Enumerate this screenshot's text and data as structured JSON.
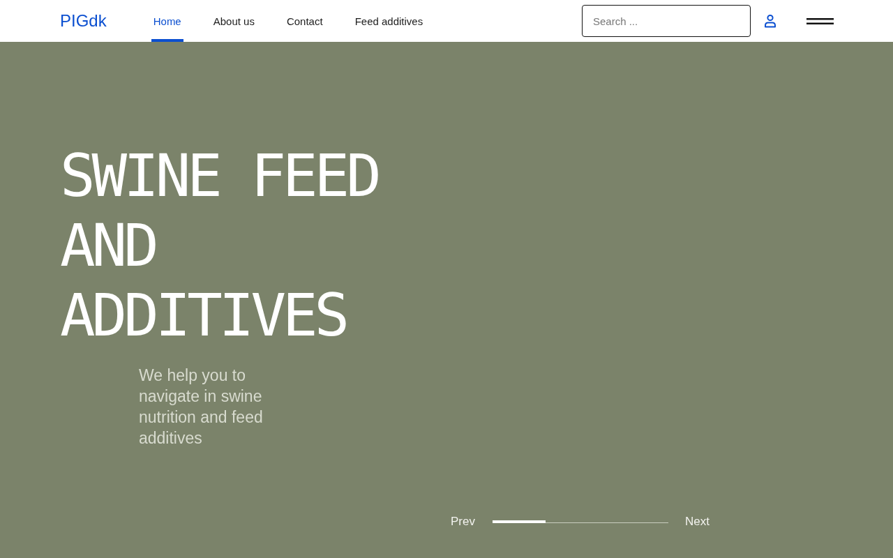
{
  "header": {
    "logo": "PIGdk",
    "nav": [
      {
        "label": "Home",
        "selected": true
      },
      {
        "label": "About us",
        "selected": false
      },
      {
        "label": "Contact",
        "selected": false
      },
      {
        "label": "Feed additives",
        "selected": false
      }
    ],
    "search": {
      "placeholder": "Search ..."
    }
  },
  "hero": {
    "title": "SWINE FEED AND ADDITIVES",
    "subtitle": "We help you to navigate in swine nutrition and feed additives",
    "carousel": {
      "prev": "Prev",
      "next": "Next",
      "level": 0.3
    }
  }
}
